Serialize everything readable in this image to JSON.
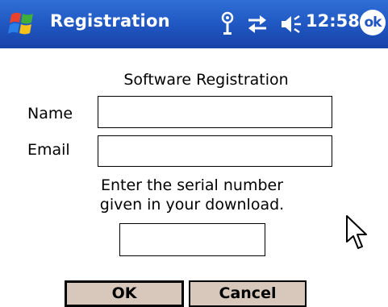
{
  "title_bar": {
    "app_title": "Registration",
    "clock": "12:58",
    "ok_label": "ok",
    "icons": [
      "windows-start-icon",
      "antenna-icon",
      "sync-icon",
      "speaker-icon"
    ]
  },
  "form": {
    "heading": "Software Registration",
    "name_label": "Name",
    "name_value": "",
    "email_label": "Email",
    "email_value": "",
    "instructions_line1": "Enter the serial number",
    "instructions_line2": "given in your download.",
    "serial_value": ""
  },
  "buttons": {
    "ok_label": "OK",
    "cancel_label": "Cancel"
  },
  "colors": {
    "title_bar": "#1f55c0",
    "button_face": "#d8c8bc"
  }
}
